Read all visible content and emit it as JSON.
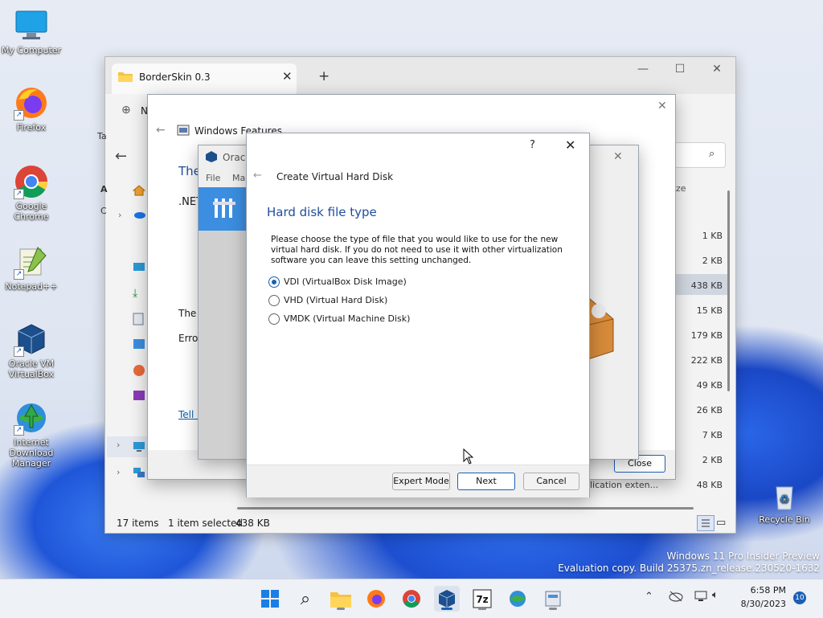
{
  "desktop": {
    "icons": [
      {
        "label": "My Computer"
      },
      {
        "label": "Firefox"
      },
      {
        "label": "Google Chrome"
      },
      {
        "label": "Notepad++"
      },
      {
        "label": "Oracle VM VirtualBox"
      },
      {
        "label": "Internet Download Manager"
      },
      {
        "label": "Recycle Bin"
      }
    ],
    "watermark_line1": "Windows 11 Pro Insider Preview",
    "watermark_line2": "Evaluation copy. Build 25375.zn_release.230520-1632"
  },
  "explorer": {
    "tab_title": "BorderSkin 0.3",
    "new_btn_letter": "N",
    "left_partial_text": "Ta",
    "column_header_partial": "ze",
    "sizes": [
      "1 KB",
      "2 KB",
      "438 KB",
      "15 KB",
      "179 KB",
      "222 KB",
      "49 KB",
      "26 KB",
      "7 KB",
      "2 KB",
      "48 KB"
    ],
    "status_items": "17 items",
    "status_selected": "1 item selected",
    "status_size": "438 KB",
    "partial_row_text": "lication exten...",
    "side_letters": [
      "A",
      "C"
    ]
  },
  "windows_features": {
    "title": "Windows Features",
    "heading_partial": "The",
    "net_partial": ".NET",
    "text_partial": "The c",
    "error_partial": "Error",
    "link_partial": "Tell n",
    "close_button": "Close"
  },
  "virtualbox": {
    "title_partial": "Oracl",
    "menu_file": "File",
    "menu_machine_partial": "Ma"
  },
  "vhd_dialog": {
    "help": "?",
    "title": "Create Virtual Hard Disk",
    "heading": "Hard disk file type",
    "description": "Please choose the type of file that you would like to use for the new virtual hard disk. If you do not need to use it with other virtualization software you can leave this setting unchanged.",
    "options": [
      {
        "label": "VDI (VirtualBox Disk Image)",
        "selected": true
      },
      {
        "label": "VHD (Virtual Hard Disk)",
        "selected": false
      },
      {
        "label": "VMDK (Virtual Machine Disk)",
        "selected": false
      }
    ],
    "buttons": {
      "expert": "Expert Mode",
      "next": "Next",
      "cancel": "Cancel"
    }
  },
  "taskbar": {
    "time": "6:58 PM",
    "date": "8/30/2023",
    "notification_count": "10"
  },
  "colors": {
    "accent": "#1a5fb4",
    "link": "#0b5cad",
    "heading": "#1f4e99"
  }
}
